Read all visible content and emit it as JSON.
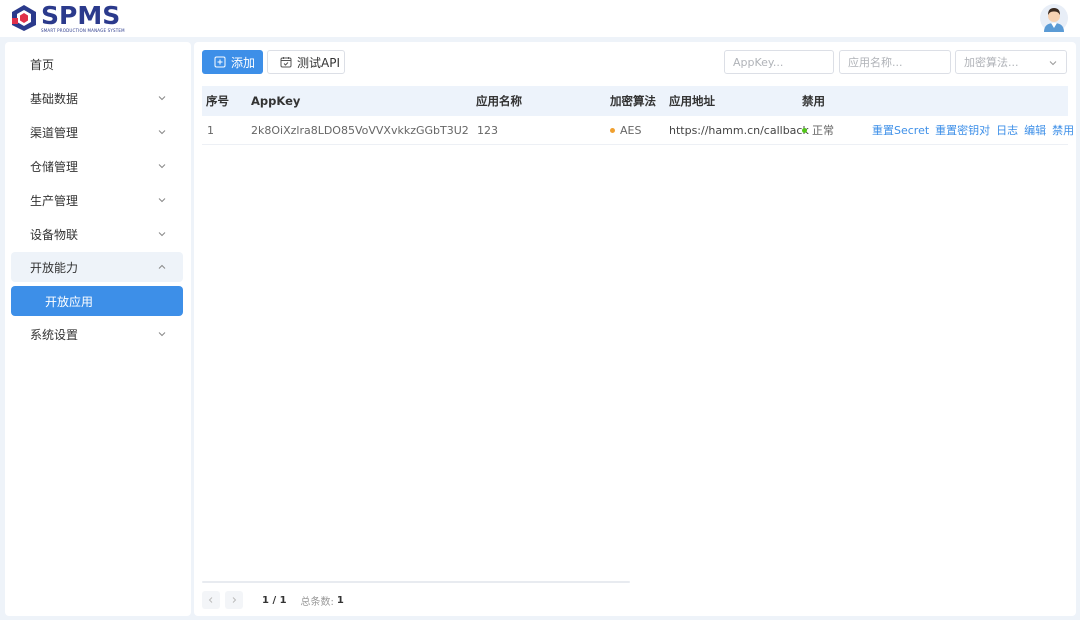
{
  "header": {
    "logo_title": "SPMS",
    "logo_subtitle": "SMART PRODUCTION MANAGE SYSTEM",
    "avatar_icon": "user-avatar-icon"
  },
  "sidebar": {
    "items": [
      {
        "label": "首页",
        "expandable": false
      },
      {
        "label": "基础数据",
        "expandable": true
      },
      {
        "label": "渠道管理",
        "expandable": true
      },
      {
        "label": "仓储管理",
        "expandable": true
      },
      {
        "label": "生产管理",
        "expandable": true
      },
      {
        "label": "设备物联",
        "expandable": true
      },
      {
        "label": "开放能力",
        "expandable": true,
        "open": true
      },
      {
        "label": "开放应用",
        "active": true
      },
      {
        "label": "系统设置",
        "expandable": true
      }
    ]
  },
  "toolbar": {
    "add_label": "添加",
    "test_api_label": "测试API",
    "appkey_placeholder": "AppKey...",
    "appname_placeholder": "应用名称...",
    "algo_placeholder": "加密算法..."
  },
  "table": {
    "columns": [
      "序号",
      "AppKey",
      "应用名称",
      "加密算法",
      "应用地址",
      "禁用"
    ],
    "rows": [
      {
        "index": "1",
        "appkey": "2k8OiXzlra8LDO85VoVVXvkkzGGbT3U2",
        "name": "123",
        "algo": "AES",
        "url": "https://hamm.cn/callback",
        "status": "正常",
        "actions": [
          "重置Secret",
          "重置密钥对",
          "日志",
          "编辑",
          "禁用"
        ]
      }
    ]
  },
  "pagination": {
    "page_info": "1 / 1",
    "total_label": "总条数:",
    "total": "1"
  },
  "colors": {
    "primary": "#3d8fe8",
    "algo_dot": "#f0a030",
    "status_dot": "#52c41a",
    "brand": "#2b3a8c"
  }
}
